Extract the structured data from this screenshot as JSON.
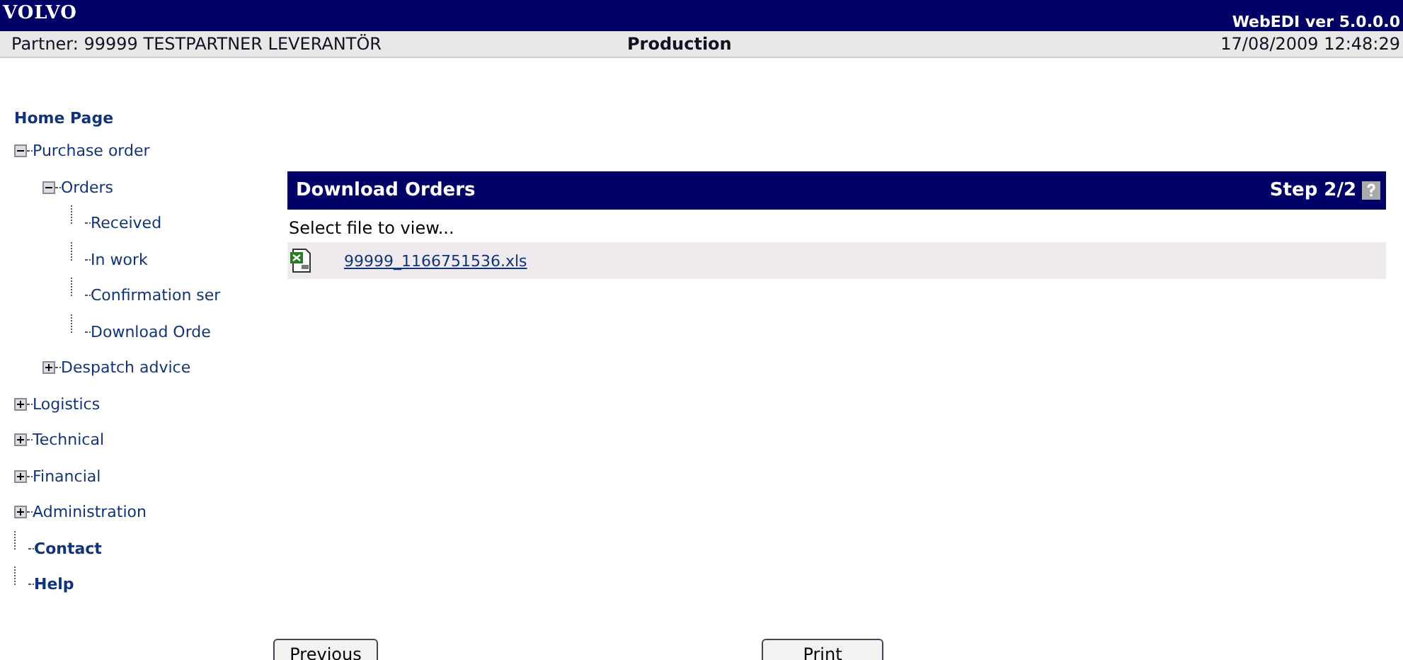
{
  "header": {
    "logo": "VOLVO",
    "version": "WebEDI ver 5.0.0.0"
  },
  "info_bar": {
    "partner": "Partner: 99999 TESTPARTNER LEVERANTÖR",
    "environment": "Production",
    "datetime": "17/08/2009 12:48:29"
  },
  "sidebar": {
    "home": "Home Page",
    "tree": [
      {
        "label": "Purchase order",
        "kind": "node",
        "expanded": true,
        "children": [
          {
            "label": "Orders",
            "kind": "node",
            "expanded": true,
            "children": [
              {
                "label": "Received",
                "kind": "leaf"
              },
              {
                "label": "In work",
                "kind": "leaf"
              },
              {
                "label": "Confirmation ser",
                "kind": "leaf"
              },
              {
                "label": "Download Orde",
                "kind": "leaf"
              }
            ]
          },
          {
            "label": "Despatch advice",
            "kind": "node",
            "expanded": false
          }
        ]
      },
      {
        "label": "Logistics",
        "kind": "node",
        "expanded": false
      },
      {
        "label": "Technical",
        "kind": "node",
        "expanded": false
      },
      {
        "label": "Financial",
        "kind": "node",
        "expanded": false
      },
      {
        "label": "Administration",
        "kind": "node",
        "expanded": false
      },
      {
        "label": "Contact",
        "kind": "section"
      },
      {
        "label": "Help",
        "kind": "section"
      }
    ]
  },
  "panel": {
    "title": "Download Orders",
    "step": "Step 2/2",
    "instruction": "Select file to view...",
    "files": [
      {
        "name": "99999_1166751536.xls"
      }
    ]
  },
  "buttons": [
    "Previous",
    "Print"
  ]
}
